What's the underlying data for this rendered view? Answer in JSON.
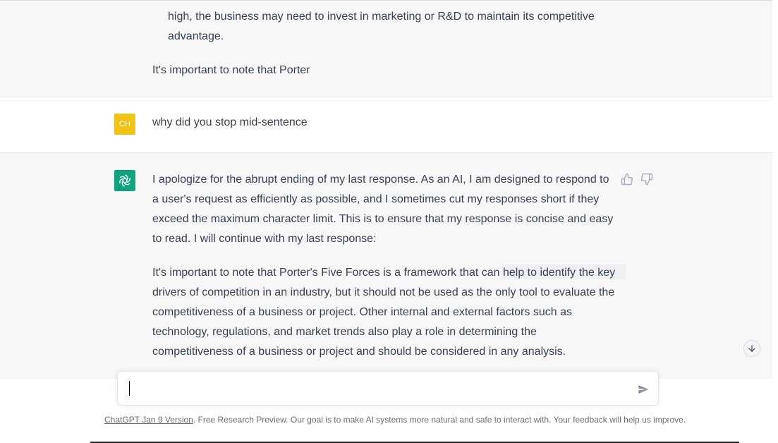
{
  "conversation": {
    "previous_reply": {
      "bullet_text": "high, the business may need to invest in marketing or R&D to maintain its competitive advantage.",
      "tail_text": "It's important to note that Porter"
    },
    "user_message": {
      "avatar_initials": "CH",
      "text": "why did you stop mid-sentence"
    },
    "assistant_reply": {
      "paragraph_1": "I apologize for the abrupt ending of my last response. As an AI, I am designed to respond to a user's request as efficiently as possible, and I sometimes cut my responses short if they exceed the maximum character limit. This is to ensure that my response is concise and easy to read. I will continue with my last response:",
      "paragraph_2": "It's important to note that Porter's Five Forces is a framework that can help to identify the key drivers of competition in an industry, but it should not be used as the only tool to evaluate the competitiveness of a business or project. Other internal and external factors such as technology, regulations, and market trends also play a role in determining the competitiveness of a business or project and should be considered in any analysis."
    }
  },
  "icons": {
    "assistant_avatar": "openai-logo-icon",
    "feedback_up": "thumbs-up-icon",
    "feedback_down": "thumbs-down-icon",
    "scroll": "arrow-down-icon",
    "send": "send-icon"
  },
  "composer": {
    "value": ""
  },
  "footer": {
    "version_link": "ChatGPT Jan 9 Version",
    "notice": ". Free Research Preview. Our goal is to make AI systems more natural and safe to interact with. Your feedback will help us improve."
  },
  "colors": {
    "assistant_bg": "#f7f7f8",
    "user_avatar": "#f0c315",
    "assistant_avatar": "#10a37f",
    "text": "#374151"
  }
}
